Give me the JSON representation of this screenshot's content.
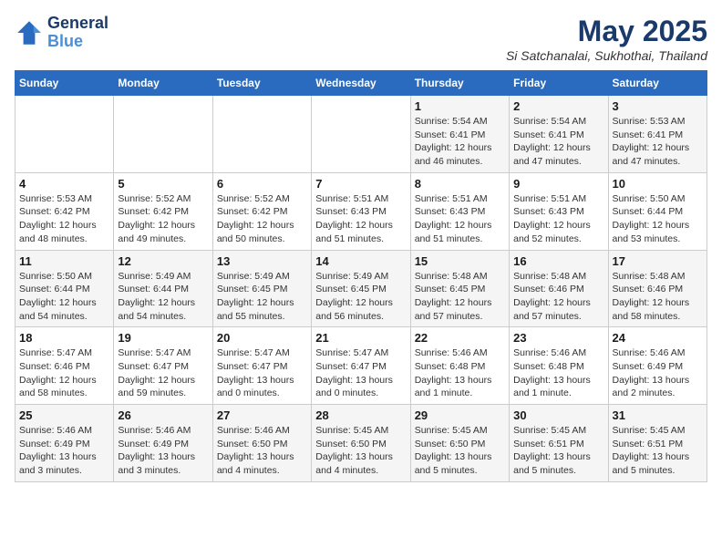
{
  "header": {
    "logo_line1": "General",
    "logo_line2": "Blue",
    "month": "May 2025",
    "location": "Si Satchanalai, Sukhothai, Thailand"
  },
  "weekdays": [
    "Sunday",
    "Monday",
    "Tuesday",
    "Wednesday",
    "Thursday",
    "Friday",
    "Saturday"
  ],
  "weeks": [
    [
      {
        "day": "",
        "info": ""
      },
      {
        "day": "",
        "info": ""
      },
      {
        "day": "",
        "info": ""
      },
      {
        "day": "",
        "info": ""
      },
      {
        "day": "1",
        "info": "Sunrise: 5:54 AM\nSunset: 6:41 PM\nDaylight: 12 hours\nand 46 minutes."
      },
      {
        "day": "2",
        "info": "Sunrise: 5:54 AM\nSunset: 6:41 PM\nDaylight: 12 hours\nand 47 minutes."
      },
      {
        "day": "3",
        "info": "Sunrise: 5:53 AM\nSunset: 6:41 PM\nDaylight: 12 hours\nand 47 minutes."
      }
    ],
    [
      {
        "day": "4",
        "info": "Sunrise: 5:53 AM\nSunset: 6:42 PM\nDaylight: 12 hours\nand 48 minutes."
      },
      {
        "day": "5",
        "info": "Sunrise: 5:52 AM\nSunset: 6:42 PM\nDaylight: 12 hours\nand 49 minutes."
      },
      {
        "day": "6",
        "info": "Sunrise: 5:52 AM\nSunset: 6:42 PM\nDaylight: 12 hours\nand 50 minutes."
      },
      {
        "day": "7",
        "info": "Sunrise: 5:51 AM\nSunset: 6:43 PM\nDaylight: 12 hours\nand 51 minutes."
      },
      {
        "day": "8",
        "info": "Sunrise: 5:51 AM\nSunset: 6:43 PM\nDaylight: 12 hours\nand 51 minutes."
      },
      {
        "day": "9",
        "info": "Sunrise: 5:51 AM\nSunset: 6:43 PM\nDaylight: 12 hours\nand 52 minutes."
      },
      {
        "day": "10",
        "info": "Sunrise: 5:50 AM\nSunset: 6:44 PM\nDaylight: 12 hours\nand 53 minutes."
      }
    ],
    [
      {
        "day": "11",
        "info": "Sunrise: 5:50 AM\nSunset: 6:44 PM\nDaylight: 12 hours\nand 54 minutes."
      },
      {
        "day": "12",
        "info": "Sunrise: 5:49 AM\nSunset: 6:44 PM\nDaylight: 12 hours\nand 54 minutes."
      },
      {
        "day": "13",
        "info": "Sunrise: 5:49 AM\nSunset: 6:45 PM\nDaylight: 12 hours\nand 55 minutes."
      },
      {
        "day": "14",
        "info": "Sunrise: 5:49 AM\nSunset: 6:45 PM\nDaylight: 12 hours\nand 56 minutes."
      },
      {
        "day": "15",
        "info": "Sunrise: 5:48 AM\nSunset: 6:45 PM\nDaylight: 12 hours\nand 57 minutes."
      },
      {
        "day": "16",
        "info": "Sunrise: 5:48 AM\nSunset: 6:46 PM\nDaylight: 12 hours\nand 57 minutes."
      },
      {
        "day": "17",
        "info": "Sunrise: 5:48 AM\nSunset: 6:46 PM\nDaylight: 12 hours\nand 58 minutes."
      }
    ],
    [
      {
        "day": "18",
        "info": "Sunrise: 5:47 AM\nSunset: 6:46 PM\nDaylight: 12 hours\nand 58 minutes."
      },
      {
        "day": "19",
        "info": "Sunrise: 5:47 AM\nSunset: 6:47 PM\nDaylight: 12 hours\nand 59 minutes."
      },
      {
        "day": "20",
        "info": "Sunrise: 5:47 AM\nSunset: 6:47 PM\nDaylight: 13 hours\nand 0 minutes."
      },
      {
        "day": "21",
        "info": "Sunrise: 5:47 AM\nSunset: 6:47 PM\nDaylight: 13 hours\nand 0 minutes."
      },
      {
        "day": "22",
        "info": "Sunrise: 5:46 AM\nSunset: 6:48 PM\nDaylight: 13 hours\nand 1 minute."
      },
      {
        "day": "23",
        "info": "Sunrise: 5:46 AM\nSunset: 6:48 PM\nDaylight: 13 hours\nand 1 minute."
      },
      {
        "day": "24",
        "info": "Sunrise: 5:46 AM\nSunset: 6:49 PM\nDaylight: 13 hours\nand 2 minutes."
      }
    ],
    [
      {
        "day": "25",
        "info": "Sunrise: 5:46 AM\nSunset: 6:49 PM\nDaylight: 13 hours\nand 3 minutes."
      },
      {
        "day": "26",
        "info": "Sunrise: 5:46 AM\nSunset: 6:49 PM\nDaylight: 13 hours\nand 3 minutes."
      },
      {
        "day": "27",
        "info": "Sunrise: 5:46 AM\nSunset: 6:50 PM\nDaylight: 13 hours\nand 4 minutes."
      },
      {
        "day": "28",
        "info": "Sunrise: 5:45 AM\nSunset: 6:50 PM\nDaylight: 13 hours\nand 4 minutes."
      },
      {
        "day": "29",
        "info": "Sunrise: 5:45 AM\nSunset: 6:50 PM\nDaylight: 13 hours\nand 5 minutes."
      },
      {
        "day": "30",
        "info": "Sunrise: 5:45 AM\nSunset: 6:51 PM\nDaylight: 13 hours\nand 5 minutes."
      },
      {
        "day": "31",
        "info": "Sunrise: 5:45 AM\nSunset: 6:51 PM\nDaylight: 13 hours\nand 5 minutes."
      }
    ]
  ]
}
